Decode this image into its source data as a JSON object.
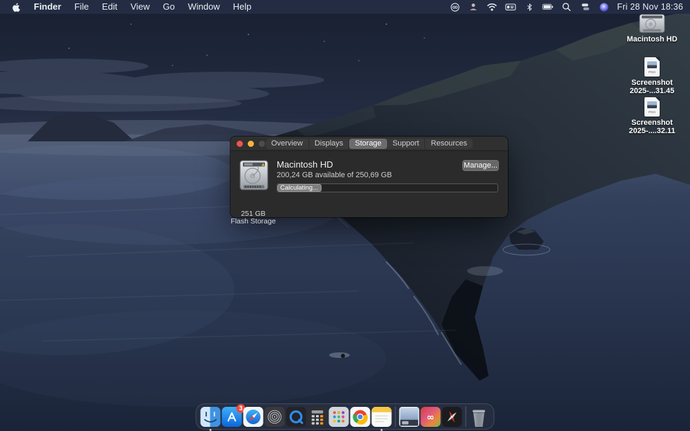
{
  "colors": {
    "menubar_bg": "rgba(36,45,68,0.95)",
    "window_bg": "#2b2b2b",
    "segment_selected": "#6c6c6c",
    "button_bg": "#676767",
    "progress_chip": "#7d7d7d",
    "badge_red": "#ec4b3f",
    "traffic_red": "#f0554f",
    "traffic_yellow": "#f5b53d",
    "sky_top": "#181f30",
    "ocean_deep": "#1a2438"
  },
  "menubar": {
    "app_name": "Finder",
    "menus": [
      "File",
      "Edit",
      "View",
      "Go",
      "Window",
      "Help"
    ],
    "status_icons": [
      "creative-cloud",
      "user-bust",
      "wifi",
      "keyboard-input",
      "bluetooth",
      "battery",
      "spotlight",
      "window-stack",
      "siri-orb"
    ],
    "clock": "Fri 28 Nov 18:36"
  },
  "desktop": {
    "icons": [
      {
        "label": "Macintosh HD",
        "type": "drive"
      },
      {
        "label_line1": "Screenshot",
        "label_line2": "2025-...31.45",
        "type": "png",
        "file_type": "PNG"
      },
      {
        "label_line1": "Screenshot",
        "label_line2": "2025-....32.11",
        "type": "png",
        "file_type": "PNG"
      }
    ]
  },
  "window": {
    "tabs": [
      {
        "label": "Overview",
        "selected": false
      },
      {
        "label": "Displays",
        "selected": false
      },
      {
        "label": "Storage",
        "selected": true
      },
      {
        "label": "Support",
        "selected": false
      },
      {
        "label": "Resources",
        "selected": false
      }
    ],
    "drive": {
      "name": "Macintosh HD",
      "availability": "200,24 GB available of 250,69 GB",
      "progress_label": "Calculating...",
      "manage_button": "Manage...",
      "capacity": "251 GB",
      "kind": "Flash Storage"
    }
  },
  "dock": {
    "apps": [
      {
        "name": "finder",
        "running": true
      },
      {
        "name": "app-store",
        "badge": "3"
      },
      {
        "name": "safari"
      },
      {
        "name": "time-machine"
      },
      {
        "name": "quicktime-player"
      },
      {
        "name": "calculator"
      },
      {
        "name": "launchpad"
      },
      {
        "name": "chrome"
      },
      {
        "name": "notes",
        "running": true
      },
      {
        "name": "minimized-window"
      },
      {
        "name": "creative-cloud"
      },
      {
        "name": "dark-pinwheel-app"
      },
      {
        "name": "trash"
      }
    ]
  }
}
